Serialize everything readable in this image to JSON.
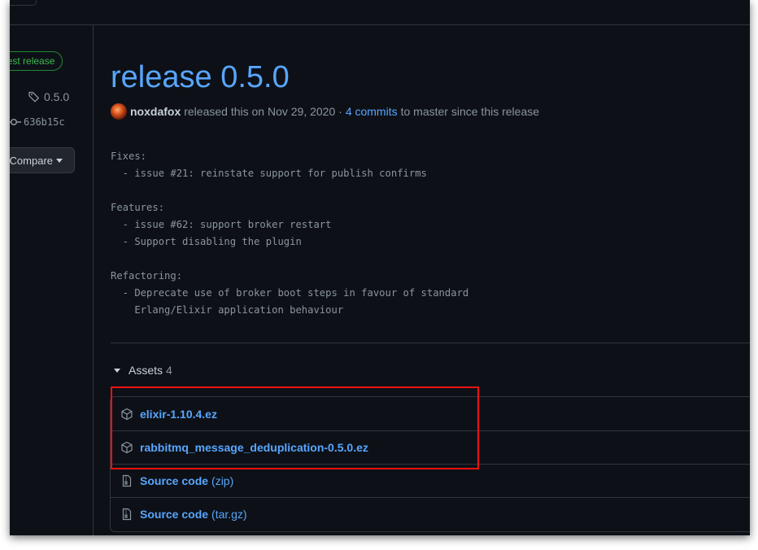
{
  "sidebar": {
    "latest_badge": "Latest release",
    "tag": "0.5.0",
    "commit": "636b15c",
    "compare_label": "Compare"
  },
  "release": {
    "title": "release 0.5.0",
    "author": "noxdafox",
    "released_text": "released this on Nov 29, 2020 ·",
    "commits_link": "4 commits",
    "commits_suffix": "to master since this release"
  },
  "notes": {
    "lines": [
      "Fixes:",
      "  - issue #21: reinstate support for publish confirms",
      "",
      "Features:",
      "  - issue #62: support broker restart",
      "  - Support disabling the plugin",
      "",
      "Refactoring:",
      "  - Deprecate use of broker boot steps in favour of standard",
      "    Erlang/Elixir application behaviour"
    ]
  },
  "assets": {
    "label": "Assets",
    "count": "4",
    "items": [
      {
        "name": "elixir-1.10.4.ez",
        "suffix": "",
        "icon": "package-icon"
      },
      {
        "name": "rabbitmq_message_deduplication-0.5.0.ez",
        "suffix": "",
        "icon": "package-icon"
      },
      {
        "name": "Source code",
        "suffix": "(zip)",
        "icon": "file-zip-icon"
      },
      {
        "name": "Source code",
        "suffix": "(tar.gz)",
        "icon": "file-zip-icon"
      }
    ]
  },
  "colors": {
    "background": "#0d1117",
    "link": "#58a6ff",
    "muted": "#8b949e",
    "border": "#30363d",
    "badge_green": "#3fb950",
    "highlight": "#ee1111"
  }
}
